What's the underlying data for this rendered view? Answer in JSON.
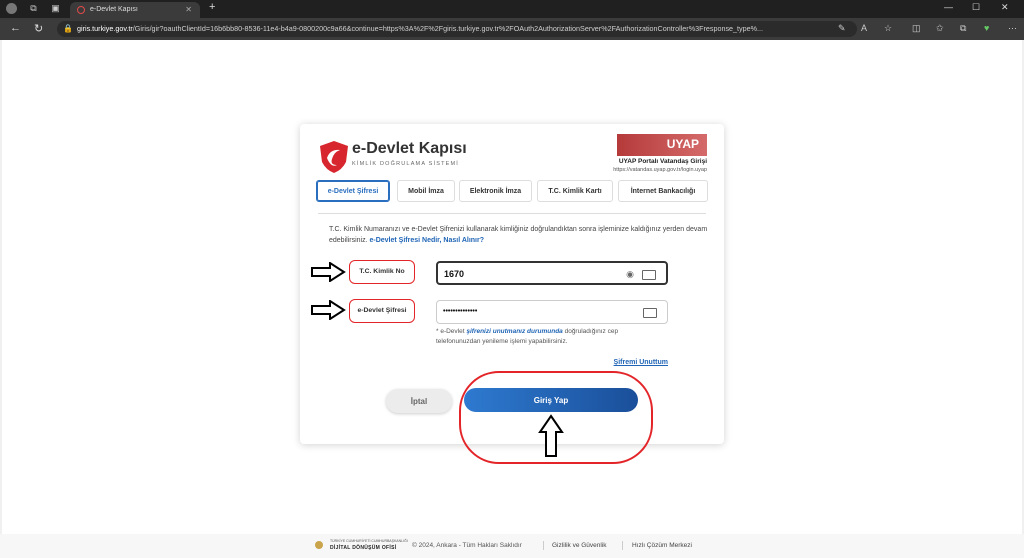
{
  "browser": {
    "tab_title": "e-Devlet Kapısı",
    "url_host": "giris.turkiye.gov.tr",
    "url_rest": "/Giris/gir?oauthClientId=16b6bb80-8536-11e4-b4a9-0800200c9a66&continue=https%3A%2F%2Fgiris.turkiye.gov.tr%2FOAuth2AuthorizationServer%2FAuthorizationController%3Fresponse_type%..."
  },
  "brand": {
    "title": "e-Devlet Kapısı",
    "subtitle": "KİMLİK DOĞRULAMA SİSTEMİ"
  },
  "uyap": {
    "logo_text": "UYAP",
    "title": "UYAP Portalı Vatandaş Girişi",
    "url": "https://vatandas.uyap.gov.tr/login.uyap"
  },
  "tabs": [
    {
      "label": "e-Devlet Şifresi",
      "active": true
    },
    {
      "label": "Mobil İmza"
    },
    {
      "label": "Elektronik İmza"
    },
    {
      "label": "T.C. Kimlik Kartı"
    },
    {
      "label": "İnternet Bankacılığı"
    }
  ],
  "info": {
    "text": "T.C. Kimlik Numaranızı ve e-Devlet Şifrenizi kullanarak kimliğiniz doğrulandıktan sonra işleminize kaldığınız yerden devam edebilirsiniz.",
    "link": "e-Devlet Şifresi Nedir, Nasıl Alınır?"
  },
  "form": {
    "tc_label": "T.C. Kimlik No",
    "tc_value": "1670",
    "pw_label": "e-Devlet Şifresi",
    "pw_value": "••••••••••••••",
    "hint_prefix": "* e-Devlet ",
    "hint_em": "şifrenizi unutmanız durumunda",
    "hint_suffix": " doğruladığınız cep telefonunuzdan yenileme işlemi yapabilirsiniz.",
    "forgot": "Şifremi Unuttum",
    "cancel": "İptal",
    "login": "Giriş Yap"
  },
  "footer": {
    "org_line1": "TÜRKİYE CUMHURİYETİ CUMHURBAŞKANLIĞI",
    "org_line2": "DİJİTAL DÖNÜŞÜM OFİSİ",
    "copyright": "© 2024, Ankara - Tüm Hakları Saklıdır",
    "privacy": "Gizlilik ve Güvenlik",
    "help": "Hızlı Çözüm Merkezi"
  },
  "colors": {
    "accent": "#2a6fbf",
    "annotation": "#e3252a"
  }
}
